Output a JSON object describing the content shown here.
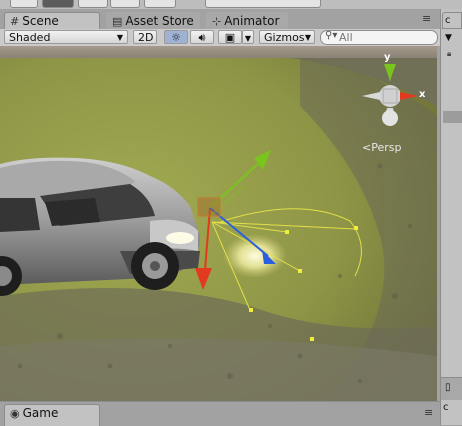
{
  "tabs": [
    {
      "label": "Scene",
      "icon": "scene-grid-icon",
      "active": true
    },
    {
      "label": "Asset Store",
      "icon": "asset-store-icon",
      "active": false
    },
    {
      "label": "Animator",
      "icon": "animator-icon",
      "active": false
    }
  ],
  "toolbar": {
    "draw_mode": "Shaded",
    "mode_2d": "2D",
    "gizmos": "Gizmos",
    "search_placeholder": "All"
  },
  "scene": {
    "projection_label": "Persp",
    "axis_x": "x",
    "axis_y": "y"
  },
  "bottom_tab": {
    "label": "Game"
  },
  "colors": {
    "x_axis": "#e23a1e",
    "y_axis": "#7ac41e",
    "z_axis": "#2a5fe0",
    "gizmo_line": "#e3df4a"
  }
}
